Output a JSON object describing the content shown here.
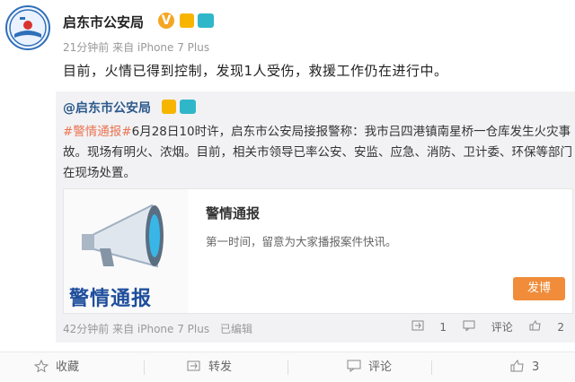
{
  "post": {
    "author": "启东市公安局",
    "verified_badge": "V",
    "meta": "21分钟前 来自 iPhone 7 Plus",
    "text": "目前，火情已得到控制，发现1人受伤，救援工作仍在进行中。"
  },
  "repost": {
    "author": "@启东市公安局",
    "hashtag": "#警情通报#",
    "text": "6月28日10时许，启东市公安局接报警称：我市吕四港镇南星桥一仓库发生火灾事故。现场有明火、浓烟。目前，相关市领导已率公安、安监、应急、消防、卫计委、环保等部门在现场处置。",
    "card": {
      "image_label": "警情通报",
      "title": "警情通报",
      "subtitle": "第一时间，留意为大家播报案件快讯。",
      "button": "发博"
    },
    "meta": "42分钟前 来自 iPhone 7 Plus",
    "edited": "已编辑",
    "actions": {
      "repost_count": "1",
      "comment_label": "评论",
      "like_label": "2"
    }
  },
  "toolbar": {
    "favorite": "收藏",
    "forward": "转发",
    "comment": "评论",
    "like_count": "3"
  },
  "colors": {
    "accent_orange": "#f08c3a",
    "hashtag": "#eb7350",
    "link_blue": "#2d5a8b"
  }
}
